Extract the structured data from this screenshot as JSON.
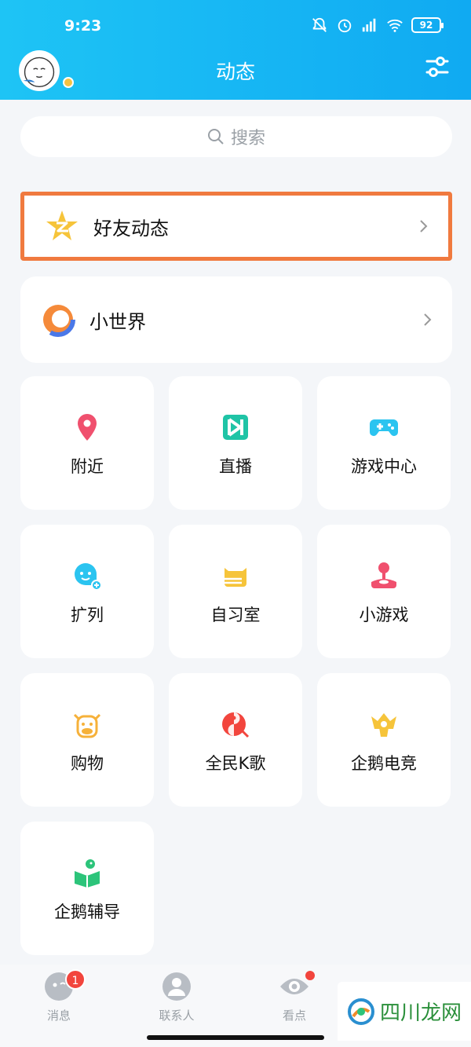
{
  "status_bar": {
    "time": "9:23",
    "battery": "92"
  },
  "header": {
    "title": "动态"
  },
  "search": {
    "placeholder": "搜索"
  },
  "rows": [
    {
      "label": "好友动态",
      "icon": "qzone-star-icon"
    },
    {
      "label": "小世界",
      "icon": "small-world-icon"
    }
  ],
  "tiles": [
    {
      "label": "附近",
      "icon": "location-pin-icon",
      "color": "#f0506e"
    },
    {
      "label": "直播",
      "icon": "live-icon",
      "color": "#1fc4a6"
    },
    {
      "label": "游戏中心",
      "icon": "gamepad-icon",
      "color": "#2bc4f0"
    },
    {
      "label": "扩列",
      "icon": "add-friend-face-icon",
      "color": "#2bc4f0"
    },
    {
      "label": "自习室",
      "icon": "study-cat-icon",
      "color": "#f6c43a"
    },
    {
      "label": "小游戏",
      "icon": "joystick-icon",
      "color": "#f0506e"
    },
    {
      "label": "购物",
      "icon": "cow-icon",
      "color": "#f6b13a"
    },
    {
      "label": "全民K歌",
      "icon": "karaoke-icon",
      "color": "#f2453d"
    },
    {
      "label": "企鹅电竞",
      "icon": "esports-crown-icon",
      "color": "#f6c43a"
    },
    {
      "label": "企鹅辅导",
      "icon": "book-tutor-icon",
      "color": "#2cc47a"
    }
  ],
  "bottom_nav": [
    {
      "label": "消息",
      "badge": "1"
    },
    {
      "label": "联系人"
    },
    {
      "label": "看点"
    }
  ],
  "watermark": {
    "text": "四川龙网"
  },
  "colors": {
    "header": "#10aaf2",
    "highlight_border": "#f07a3f",
    "badge": "#f2453d"
  }
}
